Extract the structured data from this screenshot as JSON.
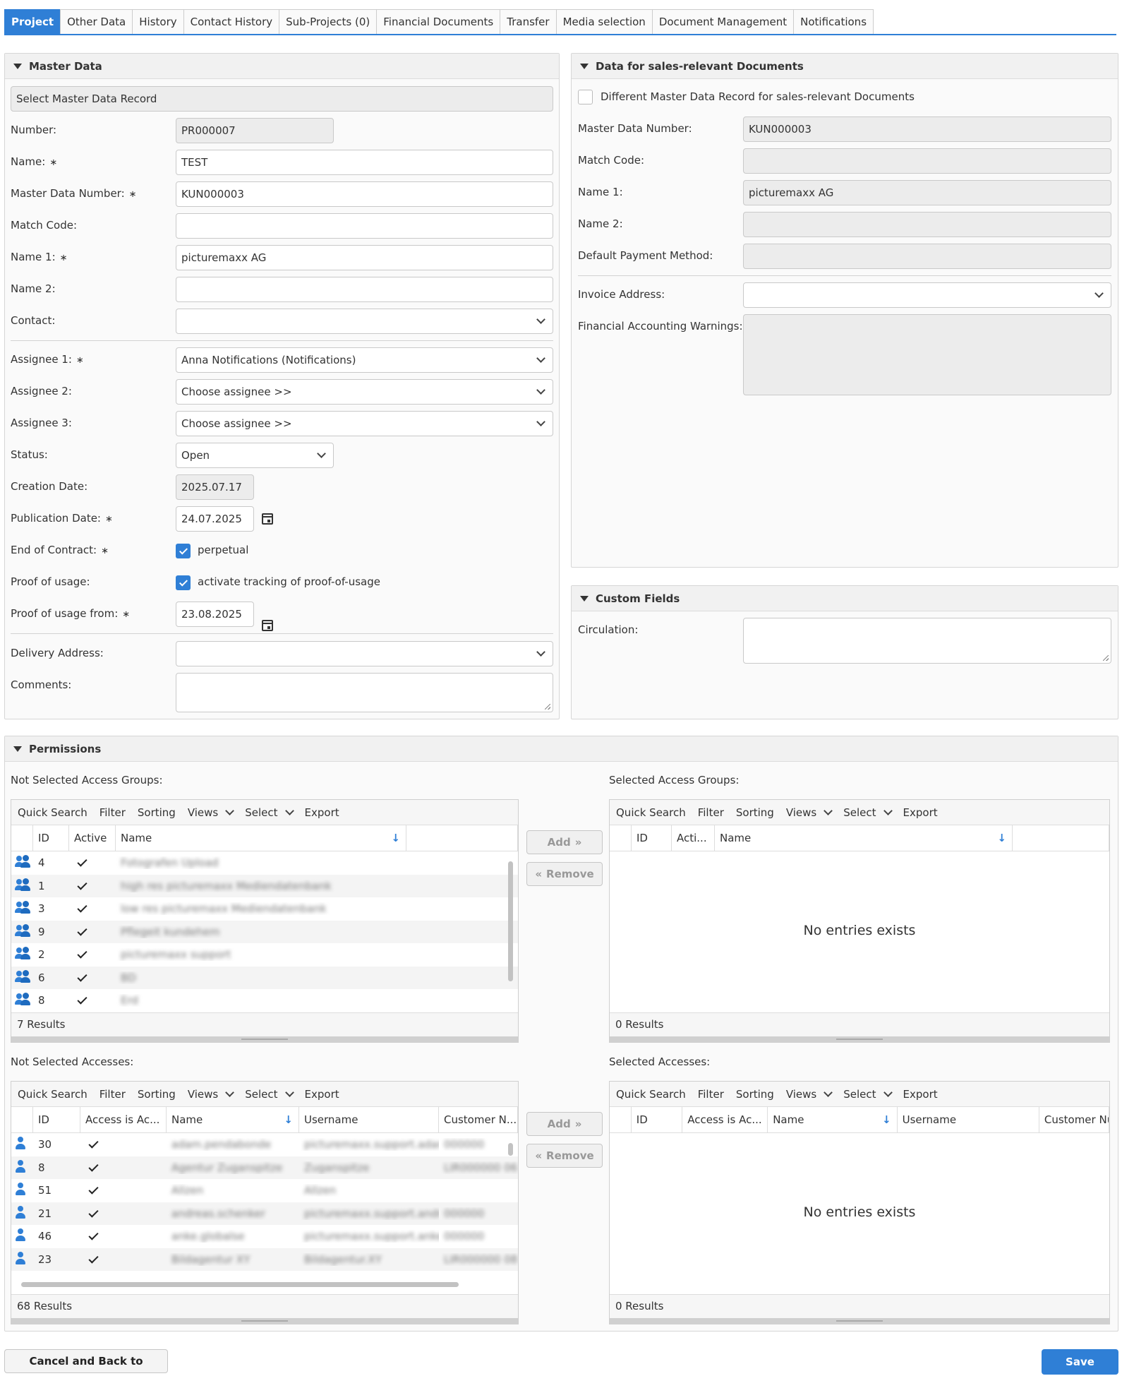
{
  "tabs": [
    "Project",
    "Other Data",
    "History",
    "Contact History",
    "Sub-Projects (0)",
    "Financial Documents",
    "Transfer",
    "Media selection",
    "Document Management",
    "Notifications"
  ],
  "master": {
    "title": "Master Data",
    "select_record": "Select Master Data Record",
    "labels": {
      "number": "Number:",
      "name": "Name:",
      "mdnumber": "Master Data Number:",
      "matchcode": "Match Code:",
      "name1": "Name 1:",
      "name2": "Name 2:",
      "contact": "Contact:",
      "assignee1": "Assignee 1:",
      "assignee2": "Assignee 2:",
      "assignee3": "Assignee 3:",
      "status": "Status:",
      "creation": "Creation Date:",
      "publication": "Publication Date:",
      "end_contract": "End of Contract:",
      "proof": "Proof of usage:",
      "proof_from": "Proof of usage from:",
      "delivery": "Delivery Address:",
      "comments": "Comments:"
    },
    "values": {
      "number": "PR000007",
      "name": "TEST",
      "mdnumber": "KUN000003",
      "matchcode": "",
      "name1": "picturemaxx AG",
      "name2": "",
      "contact": "",
      "assignee1": "Anna Notifications (Notifications)",
      "assignee2": "Choose assignee >>",
      "assignee3": "Choose assignee >>",
      "status": "Open",
      "creation": "2025.07.17",
      "publication": "24.07.2025",
      "end_contract": "perpetual",
      "proof": "activate tracking of proof-of-usage",
      "proof_from": "23.08.2025",
      "delivery": "",
      "comments": ""
    },
    "required_mark": "∗"
  },
  "sales": {
    "title": "Data for sales-relevant Documents",
    "diff_label": "Different Master Data Record for sales-relevant Documents",
    "labels": {
      "mdnumber": "Master Data Number:",
      "matchcode": "Match Code:",
      "name1": "Name 1:",
      "name2": "Name 2:",
      "payment": "Default Payment Method:",
      "invoice": "Invoice Address:",
      "warnings": "Financial Accounting Warnings:"
    },
    "values": {
      "mdnumber": "KUN000003",
      "matchcode": "",
      "name1": "picturemaxx AG",
      "name2": "",
      "payment": "",
      "invoice": "",
      "warnings": ""
    }
  },
  "custom": {
    "title": "Custom Fields",
    "circulation_label": "Circulation:",
    "circulation": ""
  },
  "permissions": {
    "title": "Permissions",
    "toolbar": {
      "quick": "Quick Search",
      "filter": "Filter",
      "sorting": "Sorting",
      "views": "Views",
      "select": "Select",
      "export": "Export"
    },
    "ns_groups_label": "Not Selected Access Groups:",
    "s_groups_label": "Selected Access Groups:",
    "ns_access_label": "Not Selected Accesses:",
    "s_access_label": "Selected Accesses:",
    "group_cols": {
      "id": "ID",
      "active": "Active",
      "name": "Name"
    },
    "sel_group_cols": {
      "id": "ID",
      "active": "Acti...",
      "name": "Name"
    },
    "access_cols": {
      "id": "ID",
      "active": "Access is Ac...",
      "name": "Name",
      "username": "Username",
      "customer": "Customer N..."
    },
    "sel_access_cols": {
      "id": "ID",
      "active": "Access is Ac...",
      "name": "Name",
      "username": "Username",
      "customer": "Customer Nu"
    },
    "group_rows": [
      {
        "id": "4",
        "name": "Fotografen Upload"
      },
      {
        "id": "1",
        "name": "high res picturemaxx Mediendatenbank"
      },
      {
        "id": "3",
        "name": "low res picturemaxx Mediendatenbank"
      },
      {
        "id": "9",
        "name": "Pflegeit kundehem"
      },
      {
        "id": "2",
        "name": "picturemaxx support"
      },
      {
        "id": "6",
        "name": "BD"
      },
      {
        "id": "8",
        "name": "Erd"
      }
    ],
    "access_rows": [
      {
        "id": "30",
        "name": "adam.pendabonde",
        "username": "picturemaxx.support.adam",
        "customer": "000000"
      },
      {
        "id": "8",
        "name": "Agentur Zuganspitze",
        "username": "Zuganspitze",
        "customer": "LIR000000 06"
      },
      {
        "id": "51",
        "name": "Allzen",
        "username": "Allzen",
        "customer": ""
      },
      {
        "id": "21",
        "name": "andreas.schenker",
        "username": "picturemaxx.support.andre",
        "customer": "000000"
      },
      {
        "id": "46",
        "name": "anke.globalse",
        "username": "picturemaxx.support.anke",
        "customer": "000000"
      },
      {
        "id": "23",
        "name": "Bildagentur XY",
        "username": "Bildagentur.XY",
        "customer": "LIR000000 08"
      }
    ],
    "ns_groups_results": "7 Results",
    "s_groups_results": "0 Results",
    "ns_access_results": "68 Results",
    "s_access_results": "0 Results",
    "no_entries": "No entries exists",
    "add": "Add",
    "remove": "Remove"
  },
  "footer": {
    "cancel": "Cancel and Back to Overview",
    "save": "Save"
  },
  "colors": {
    "accent": "#2f7fd6"
  }
}
